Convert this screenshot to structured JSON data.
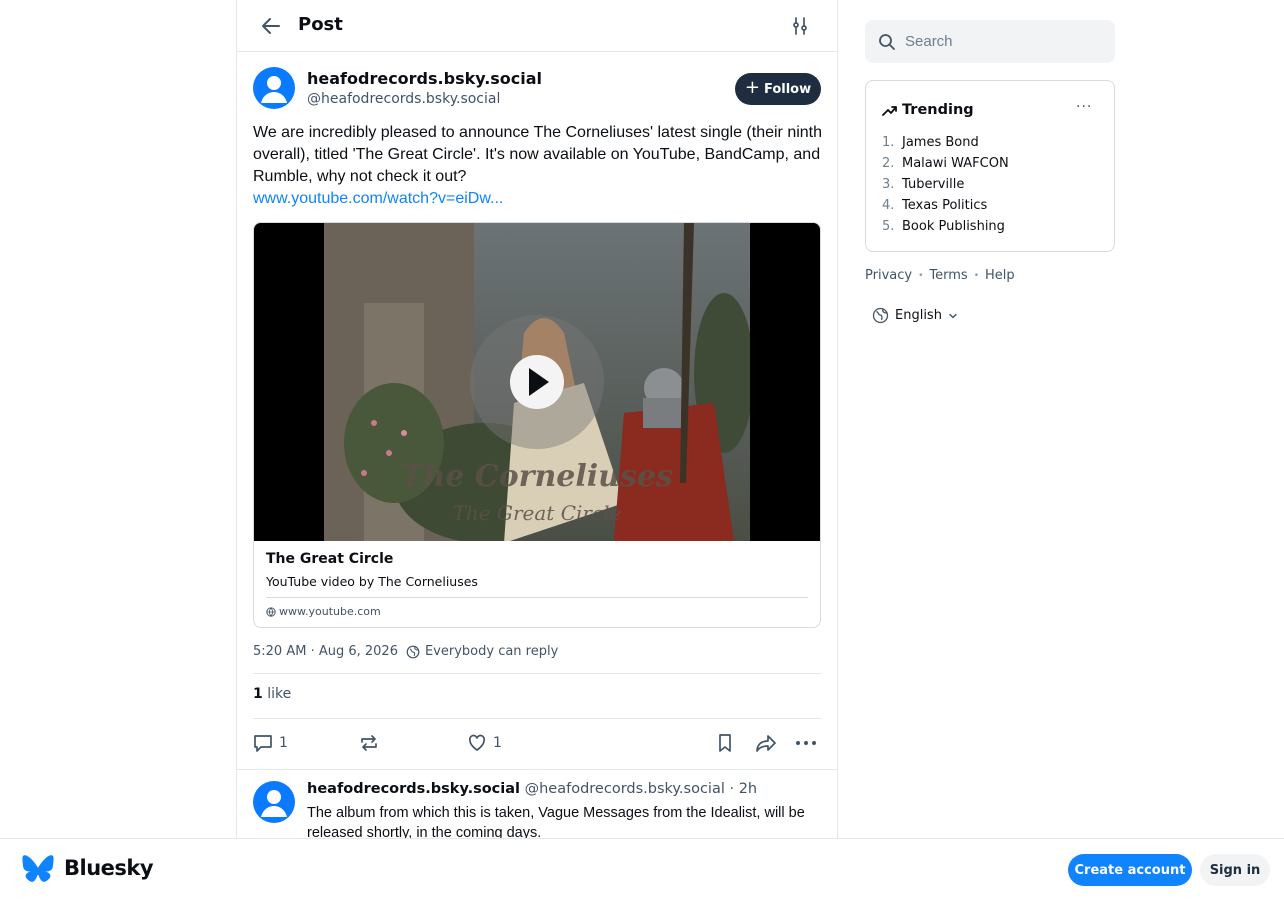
{
  "header": {
    "title": "Post"
  },
  "post": {
    "author_name": "heafodrecords.bsky.social",
    "author_handle": "@heafodrecords.bsky.social",
    "follow_label": "Follow",
    "text": "We are incredibly pleased to announce The Corneliuses' latest single (their ninth overall), titled 'The Great Circle'. It's now available on YouTube, BandCamp, and Rumble, why not check it out?",
    "link_text": "www.youtube.com/watch?v=eiDw...",
    "embed": {
      "thumb_title": "The Corneliuses",
      "thumb_subtitle": "The Great Circle",
      "title": "The Great Circle",
      "description": "YouTube video by The Corneliuses",
      "domain": "www.youtube.com"
    },
    "timestamp": "5:20 AM · Aug 6, 2026",
    "reply_setting": "Everybody can reply",
    "likes_count": "1",
    "likes_label": "like",
    "actions": {
      "reply_count": "1",
      "like_count": "1"
    }
  },
  "reply": {
    "author_name": "heafodrecords.bsky.social",
    "author_handle": "@heafodrecords.bsky.social",
    "time": "· 2h",
    "text": "The album from which this is taken, Vague Messages from the Idealist, will be released shortly, in the coming days."
  },
  "search": {
    "placeholder": "Search"
  },
  "trending": {
    "title": "Trending",
    "items": [
      {
        "num": "1.",
        "label": "James Bond"
      },
      {
        "num": "2.",
        "label": "Malawi WAFCON"
      },
      {
        "num": "3.",
        "label": "Tuberville"
      },
      {
        "num": "4.",
        "label": "Texas Politics"
      },
      {
        "num": "5.",
        "label": "Book Publishing"
      }
    ]
  },
  "footer": {
    "privacy": "Privacy",
    "terms": "Terms",
    "help": "Help",
    "language": "English"
  },
  "bottom_bar": {
    "logo": "Bluesky",
    "create_account": "Create account",
    "sign_in": "Sign in"
  },
  "colors": {
    "brand": "#1083fe",
    "follow_bg": "#1e2e40",
    "avatar": "#0a7aff"
  }
}
